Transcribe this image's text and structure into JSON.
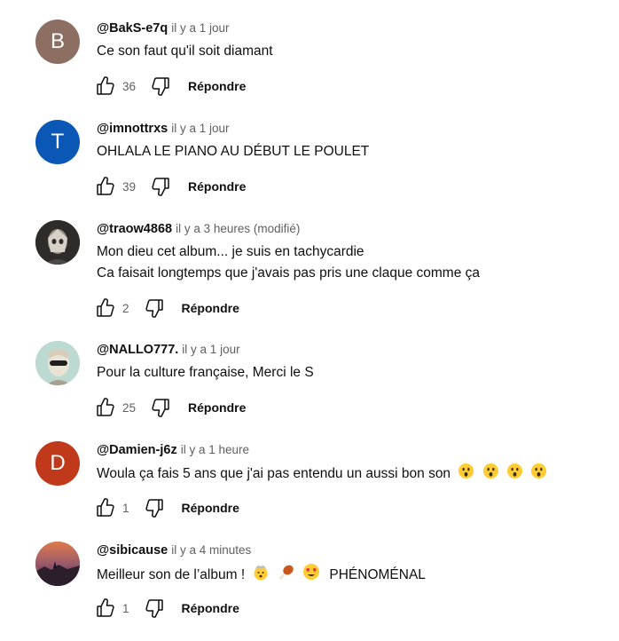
{
  "comments": [
    {
      "author": "@BakS-e7q",
      "timestamp": "il y a 1 jour",
      "lines": [
        "Ce son faut qu'il soit diamant"
      ],
      "likes": "36",
      "avatar_letter": "B",
      "avatar_color": "#8d6e63",
      "reply": "Répondre"
    },
    {
      "author": "@imnottrxs",
      "timestamp": "il y a 1 jour",
      "lines": [
        "OHLALA LE PIANO AU DÉBUT LE POULET"
      ],
      "likes": "39",
      "avatar_letter": "T",
      "avatar_color": "#0b57b6",
      "reply": "Répondre"
    },
    {
      "author": "@traow4868",
      "timestamp": "il y a 3 heures (modifié)",
      "lines": [
        "Mon dieu cet album... je suis en tachycardie",
        "Ca faisait longtemps que j'avais pas pris une claque comme ça"
      ],
      "likes": "2",
      "avatar_letter": "",
      "avatar_color": "#3b3836",
      "reply": "Répondre"
    },
    {
      "author": "@NALLO777.",
      "timestamp": "il y a 1 jour",
      "lines": [
        "Pour la culture française, Merci le S"
      ],
      "likes": "25",
      "avatar_letter": "",
      "avatar_color": "#b9d6cf",
      "reply": "Répondre"
    },
    {
      "author": "@Damien-j6z",
      "timestamp": "il y a 1 heure",
      "lines": [
        "Woula ça fais 5 ans que j'ai pas entendu un aussi bon son"
      ],
      "emojis": [
        "astonished-face",
        "astonished-face",
        "astonished-face",
        "astonished-face"
      ],
      "likes": "1",
      "avatar_letter": "D",
      "avatar_color": "#c0391b",
      "reply": "Répondre"
    },
    {
      "author": "@sibicause",
      "timestamp": "il y a 4 minutes",
      "lines": [
        "Meilleur son de l’album !"
      ],
      "emojis": [
        "exploding-head",
        "poultry-leg",
        "heart-eyes-face"
      ],
      "tail": "PHÉNOMÉNAL",
      "likes": "1",
      "avatar_letter": "",
      "avatar_color": "#6a4a5c",
      "reply": "Répondre"
    }
  ]
}
